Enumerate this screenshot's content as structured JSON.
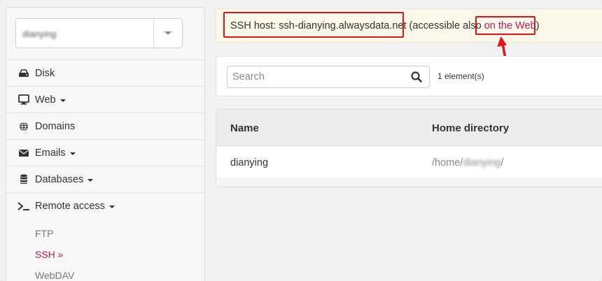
{
  "sidebar": {
    "account_name": "dianying",
    "items": [
      {
        "label": "Disk",
        "icon": "disk-icon",
        "has_dropdown": false
      },
      {
        "label": "Web",
        "icon": "monitor-icon",
        "has_dropdown": true
      },
      {
        "label": "Domains",
        "icon": "globe-icon",
        "has_dropdown": false
      },
      {
        "label": "Emails",
        "icon": "envelope-icon",
        "has_dropdown": true
      },
      {
        "label": "Databases",
        "icon": "database-icon",
        "has_dropdown": true
      },
      {
        "label": "Remote access",
        "icon": "terminal-icon",
        "has_dropdown": true
      }
    ],
    "subitems": [
      {
        "label": "FTP",
        "active": false
      },
      {
        "label": "SSH »",
        "active": true
      },
      {
        "label": "WebDAV",
        "active": false
      }
    ]
  },
  "alert": {
    "host_text": "SSH host: ssh-dianying.alwaysdata.net",
    "middle_text": " (accessible also ",
    "link_text": "on the Web",
    "end_text": ")"
  },
  "search": {
    "placeholder": "Search",
    "value": ""
  },
  "count_text": "1 element(s)",
  "table": {
    "columns": [
      "Name",
      "Home directory"
    ],
    "rows": [
      {
        "name": "dianying",
        "home_prefix": "/home/",
        "home_user": "dianying",
        "home_suffix": "/"
      }
    ]
  },
  "colors": {
    "accent": "#c2185b",
    "annotation_red": "#e0141a",
    "alert_bg": "#fbf8e9"
  }
}
